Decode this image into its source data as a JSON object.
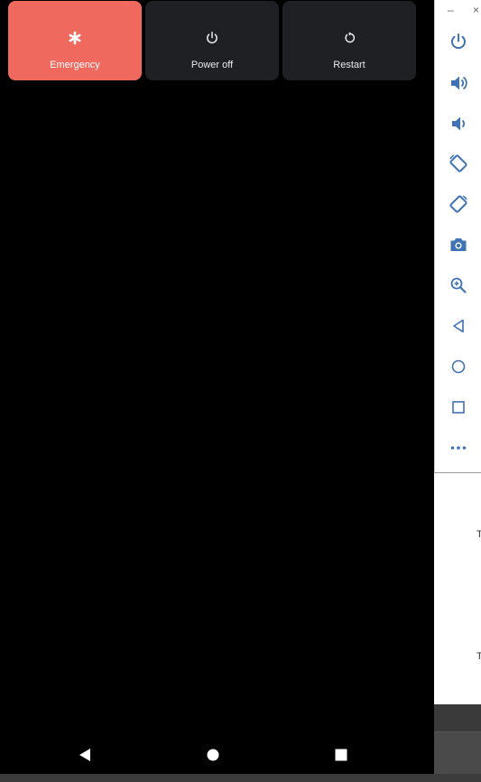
{
  "power_menu": {
    "emergency": {
      "label": "Emergency",
      "icon": "asterisk-icon",
      "color": "#f0695e"
    },
    "power_off": {
      "label": "Power off",
      "icon": "power-icon"
    },
    "restart": {
      "label": "Restart",
      "icon": "restart-icon"
    }
  },
  "nav_bar": {
    "back": "back-triangle-icon",
    "home": "home-circle-icon",
    "recents": "recents-square-icon"
  },
  "emulator_toolbar": {
    "window_controls": {
      "minimize": "–",
      "close": "×"
    },
    "tools": [
      "power-icon",
      "volume-up-icon",
      "volume-down-icon",
      "rotate-left-icon",
      "rotate-right-icon",
      "camera-icon",
      "zoom-icon",
      "back-icon",
      "home-icon",
      "overview-icon",
      "more-icon"
    ],
    "icon_color": "#3f73b5"
  },
  "background_app": {
    "letter_1": "T",
    "letter_2": "T"
  }
}
